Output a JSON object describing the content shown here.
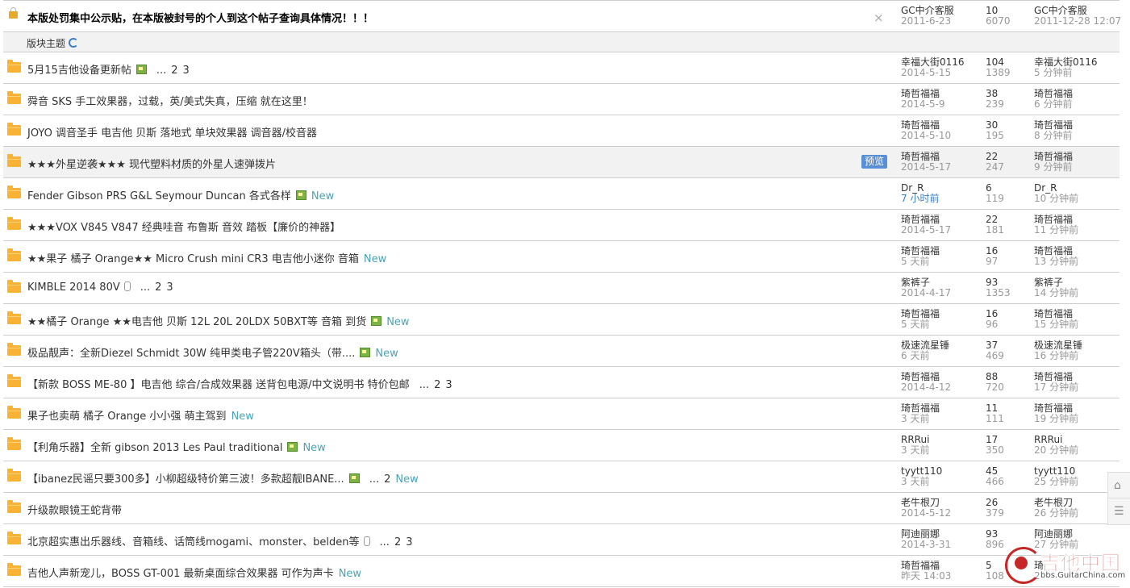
{
  "top_post": {
    "title": "本版处罚集中公示贴，在本版被封号的个人到这个帖子查询具体情况！！！",
    "author": "GC中介客服",
    "date": "2011-6-23",
    "replies": "10",
    "views": "6070",
    "last_user": "GC中介客服",
    "last_time": "2011-12-28 12:07",
    "close_symbol": "×"
  },
  "section": {
    "label": "版块主题"
  },
  "threads": [
    {
      "title": "5月15吉他设备更新帖",
      "has_image": true,
      "has_attach": false,
      "pages": [
        "...",
        "2",
        "3"
      ],
      "new": false,
      "author": "幸福大街0116",
      "date": "2014-5-15",
      "replies": "104",
      "views": "1389",
      "last_user": "幸福大街0116",
      "last_time": "5 分钟前"
    },
    {
      "title": "舜音 SKS 手工效果器，过载，英/美式失真，压缩 就在这里！",
      "has_image": false,
      "has_attach": false,
      "pages": [],
      "new": false,
      "author": "琦哲福福",
      "date": "2014-5-9",
      "replies": "38",
      "views": "239",
      "last_user": "琦哲福福",
      "last_time": "6 分钟前"
    },
    {
      "title": "JOYO 调音圣手 电吉他 贝斯 落地式 单块效果器 调音器/校音器",
      "has_image": false,
      "has_attach": false,
      "pages": [],
      "new": false,
      "author": "琦哲福福",
      "date": "2014-5-10",
      "replies": "30",
      "views": "195",
      "last_user": "琦哲福福",
      "last_time": "8 分钟前"
    },
    {
      "title": "★★★外星逆袭★★★ 现代塑料材质的外星人速弹拨片",
      "has_image": false,
      "has_attach": false,
      "pages": [],
      "new": false,
      "preview": "预览",
      "highlight": true,
      "author": "琦哲福福",
      "date": "2014-5-17",
      "replies": "22",
      "views": "247",
      "last_user": "琦哲福福",
      "last_time": "9 分钟前"
    },
    {
      "title": "Fender Gibson PRS G&L Seymour Duncan 各式各样",
      "has_image": true,
      "has_attach": false,
      "pages": [],
      "new": true,
      "author": "Dr_R",
      "date": "7 小时前",
      "date_blue": true,
      "replies": "6",
      "views": "119",
      "last_user": "Dr_R",
      "last_time": "10 分钟前"
    },
    {
      "title": "★★★VOX V845 V847 经典哇音 布鲁斯 音效 踏板【廉价的神器】",
      "has_image": false,
      "has_attach": false,
      "pages": [],
      "new": false,
      "author": "琦哲福福",
      "date": "2014-5-17",
      "replies": "22",
      "views": "181",
      "last_user": "琦哲福福",
      "last_time": "11 分钟前"
    },
    {
      "title": "★★果子 橘子 Orange★★ Micro Crush mini CR3 电吉他小迷你 音箱",
      "has_image": false,
      "has_attach": false,
      "pages": [],
      "new": true,
      "author": "琦哲福福",
      "date": "5 天前",
      "replies": "16",
      "views": "97",
      "last_user": "琦哲福福",
      "last_time": "13 分钟前"
    },
    {
      "title": "KIMBLE 2014 80V",
      "has_image": false,
      "has_attach": true,
      "pages": [
        "...",
        "2",
        "3"
      ],
      "new": false,
      "author": "紫裤子",
      "date": "2014-4-17",
      "replies": "93",
      "views": "1353",
      "last_user": "紫裤子",
      "last_time": "14 分钟前"
    },
    {
      "title": "★★橘子 Orange ★★电吉他 贝斯 12L 20L 20LDX 50BXT等 音箱 到货",
      "has_image": true,
      "has_attach": false,
      "pages": [],
      "new": true,
      "author": "琦哲福福",
      "date": "5 天前",
      "replies": "16",
      "views": "96",
      "last_user": "琦哲福福",
      "last_time": "15 分钟前"
    },
    {
      "title": "极品靓声：全新Diezel Schmidt 30W 纯甲类电子管220V箱头（带....",
      "has_image": true,
      "has_attach": false,
      "pages": [],
      "new": true,
      "author": "极速流星锤",
      "date": "6 天前",
      "replies": "37",
      "views": "469",
      "last_user": "极速流星锤",
      "last_time": "16 分钟前"
    },
    {
      "title": "【新款 BOSS ME-80 】电吉他 综合/合成效果器 送背包电源/中文说明书 特价包邮",
      "has_image": false,
      "has_attach": false,
      "pages": [
        "...",
        "2",
        "3"
      ],
      "new": false,
      "author": "琦哲福福",
      "date": "2014-4-12",
      "replies": "88",
      "views": "720",
      "last_user": "琦哲福福",
      "last_time": "17 分钟前"
    },
    {
      "title": "果子也卖萌 橘子 Orange 小小强 萌主驾到",
      "has_image": false,
      "has_attach": false,
      "pages": [],
      "new": true,
      "author": "琦哲福福",
      "date": "3 天前",
      "replies": "11",
      "views": "111",
      "last_user": "琦哲福福",
      "last_time": "19 分钟前"
    },
    {
      "title": "【利角乐器】全新 gibson 2013 Les Paul traditional",
      "has_image": true,
      "has_attach": false,
      "pages": [],
      "new": true,
      "author": "RRRui",
      "date": "3 天前",
      "replies": "17",
      "views": "350",
      "last_user": "RRRui",
      "last_time": "20 分钟前"
    },
    {
      "title": "【ibanez民谣只要300多】小柳超级特价第三波！多款超靓IBANE...",
      "has_image": true,
      "has_attach": false,
      "pages": [
        "...",
        "2"
      ],
      "new": true,
      "author": "tyytt110",
      "date": "3 天前",
      "replies": "45",
      "views": "466",
      "last_user": "tyytt110",
      "last_time": "25 分钟前"
    },
    {
      "title": "升级款眼镜王蛇背带",
      "has_image": false,
      "has_attach": false,
      "pages": [],
      "new": false,
      "author": "老牛根刀",
      "date": "2014-5-12",
      "replies": "26",
      "views": "379",
      "last_user": "老牛根刀",
      "last_time": "26 分钟前"
    },
    {
      "title": "北京超实惠出乐器线、音箱线、话筒线mogami、monster、belden等",
      "has_image": false,
      "has_attach": true,
      "pages": [
        "...",
        "2",
        "3"
      ],
      "new": false,
      "author": "阿迪丽娜",
      "date": "2014-3-31",
      "replies": "93",
      "views": "896",
      "last_user": "阿迪丽娜",
      "last_time": "27 分钟前"
    },
    {
      "title": "吉他人声新宠儿，BOSS GT-001 最新桌面综合效果器 可作为声卡",
      "has_image": false,
      "has_attach": false,
      "pages": [],
      "new": true,
      "author": "琦哲福福",
      "date": "昨天 14:03",
      "replies": "5",
      "views": "108",
      "last_user": "琦",
      "last_time": "2"
    }
  ],
  "new_label": "New",
  "side_buttons": [
    {
      "name": "back-to-top-button",
      "glyph": "⌂"
    },
    {
      "name": "list-view-button",
      "glyph": "☰"
    }
  ],
  "logo": {
    "name": "吉他中国",
    "url": "bbs.GuitarChina.com"
  },
  "colors": {
    "folder": "#f9b234",
    "new": "#4aa3b8",
    "preview": "#5a8fd8",
    "logo": "#c62828"
  }
}
